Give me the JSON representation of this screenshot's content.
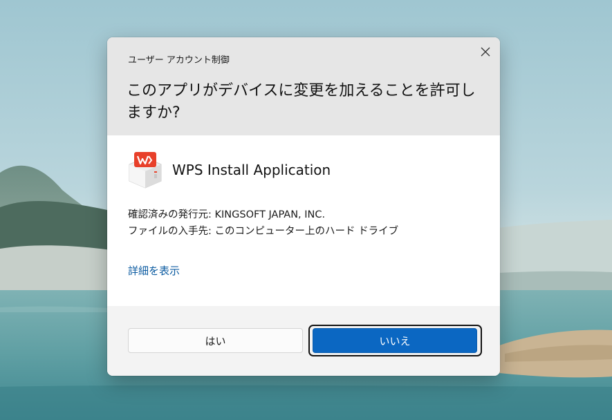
{
  "dialog": {
    "caption": "ユーザー アカウント制御",
    "question": "このアプリがデバイスに変更を加えることを許可しますか?",
    "close_icon": "close-icon",
    "app": {
      "icon": "wps-office-icon",
      "name": "WPS Install Application"
    },
    "publisher_line": "確認済みの発行元: KINGSOFT JAPAN, INC.",
    "origin_line": "ファイルの入手先: このコンピューター上のハード ドライブ",
    "details_link": "詳細を表示",
    "buttons": {
      "yes_label": "はい",
      "no_label": "いいえ"
    },
    "colors": {
      "header_bg": "#e6e6e6",
      "footer_bg": "#f3f3f3",
      "primary_button": "#0b67c2",
      "link": "#0a5aa0",
      "brand_red": "#e8402a"
    }
  }
}
